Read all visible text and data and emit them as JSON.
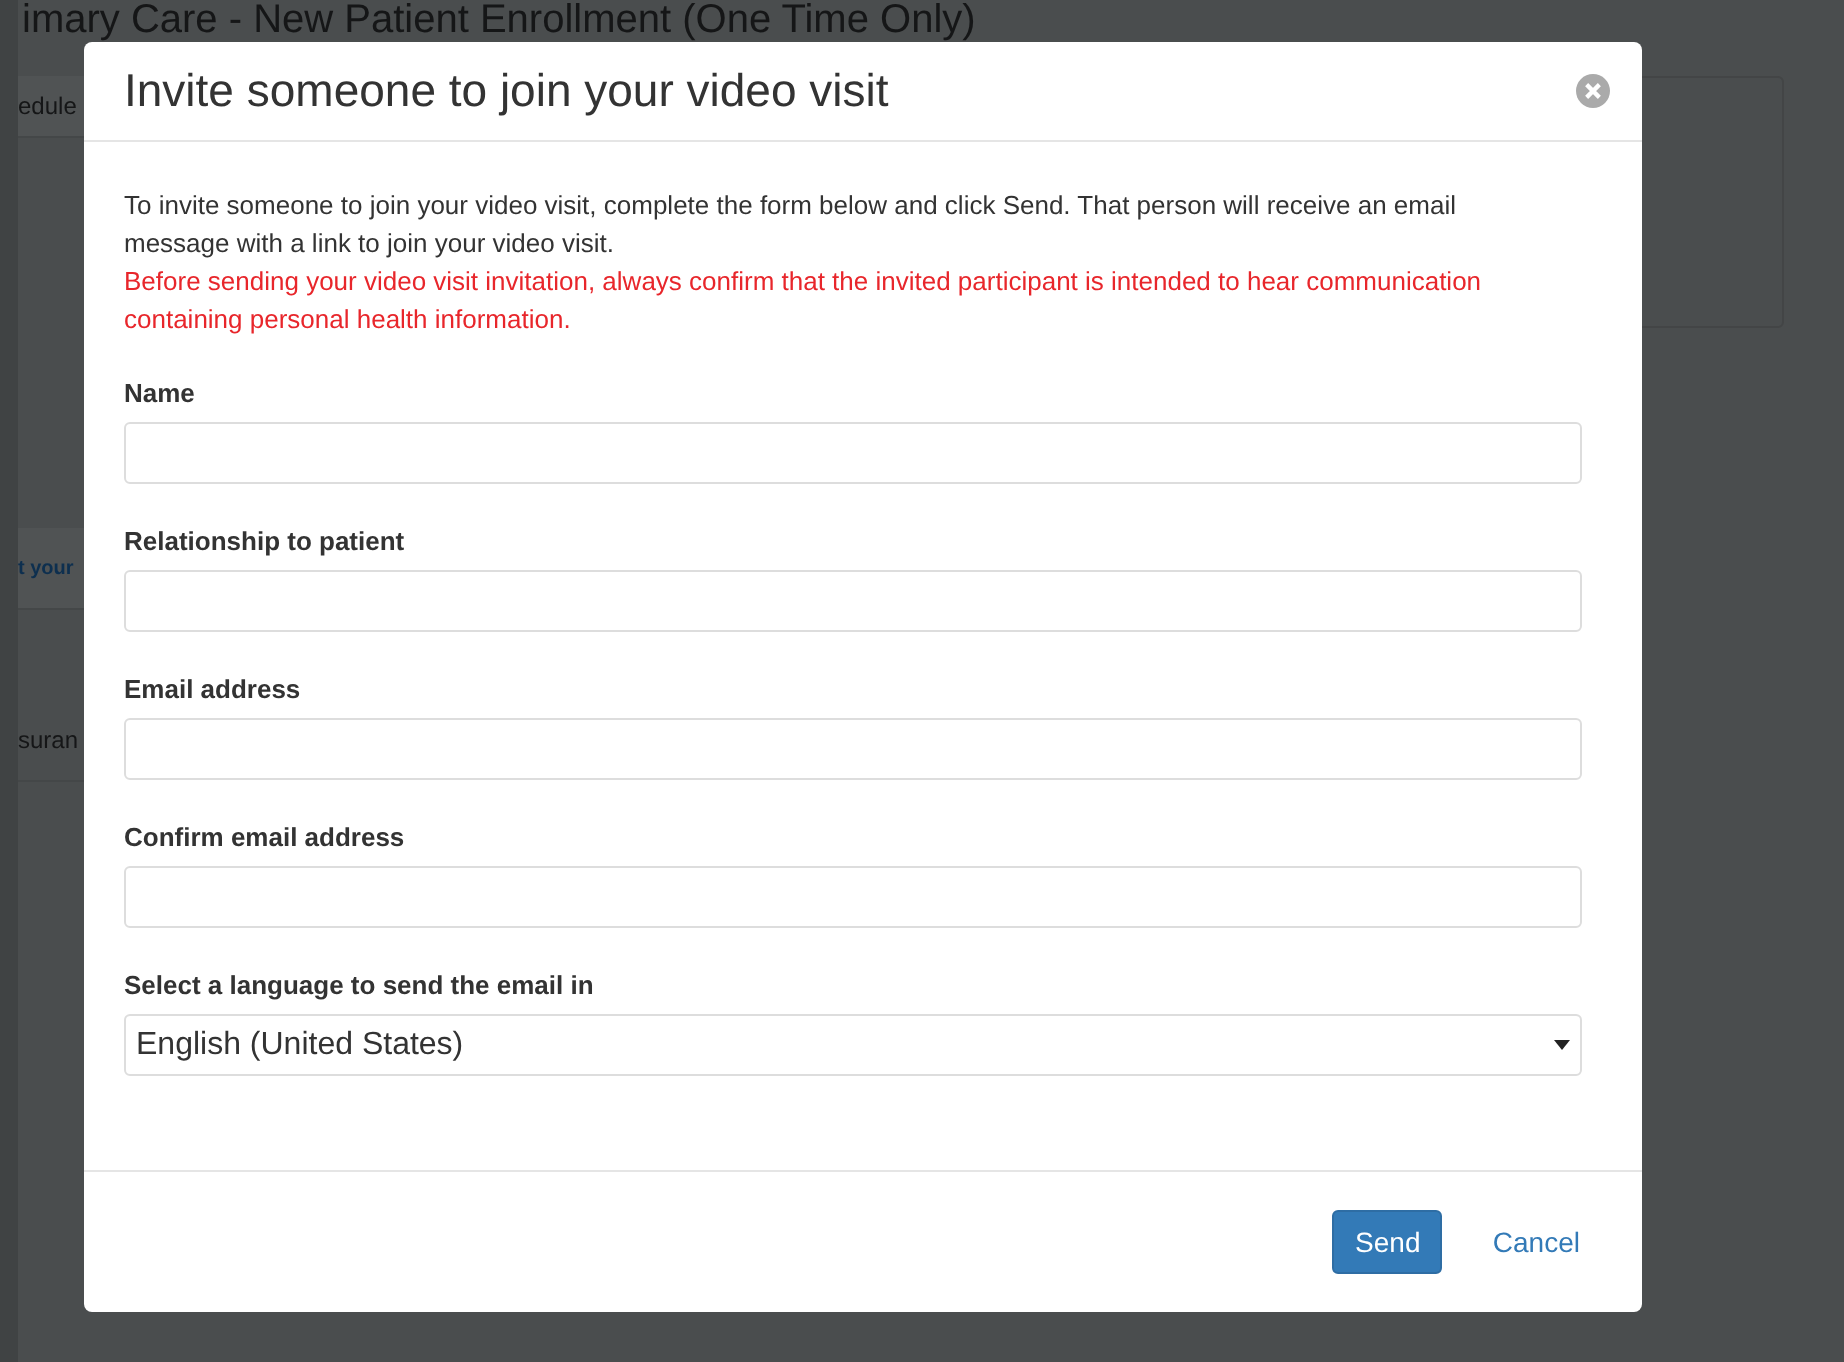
{
  "background_page": {
    "title": "imary Care - New Patient Enrollment (One Time Only)",
    "left_items": [
      {
        "label": "edule",
        "kind": "tab"
      },
      {
        "label": "t your",
        "kind": "heading"
      },
      {
        "label": "suran",
        "kind": "text"
      }
    ]
  },
  "dialog": {
    "title": "Invite someone to join your video visit",
    "intro": "To invite someone to join your video visit, complete the form below and click Send. That person will receive an email message with a link to join your video visit.",
    "warning": "Before sending your video visit invitation, always confirm that the invited participant is intended to hear communication containing personal health information.",
    "fields": [
      {
        "label": "Name",
        "kind": "text"
      },
      {
        "label": "Relationship to patient",
        "kind": "text"
      },
      {
        "label": "Email address",
        "kind": "text"
      },
      {
        "label": "Confirm email address",
        "kind": "text"
      },
      {
        "label": "Select a language to send the email in",
        "kind": "select",
        "value": "English (United States)"
      }
    ],
    "buttons": [
      {
        "label": "Send",
        "kind": "primary"
      },
      {
        "label": "Cancel",
        "kind": "link"
      }
    ]
  }
}
